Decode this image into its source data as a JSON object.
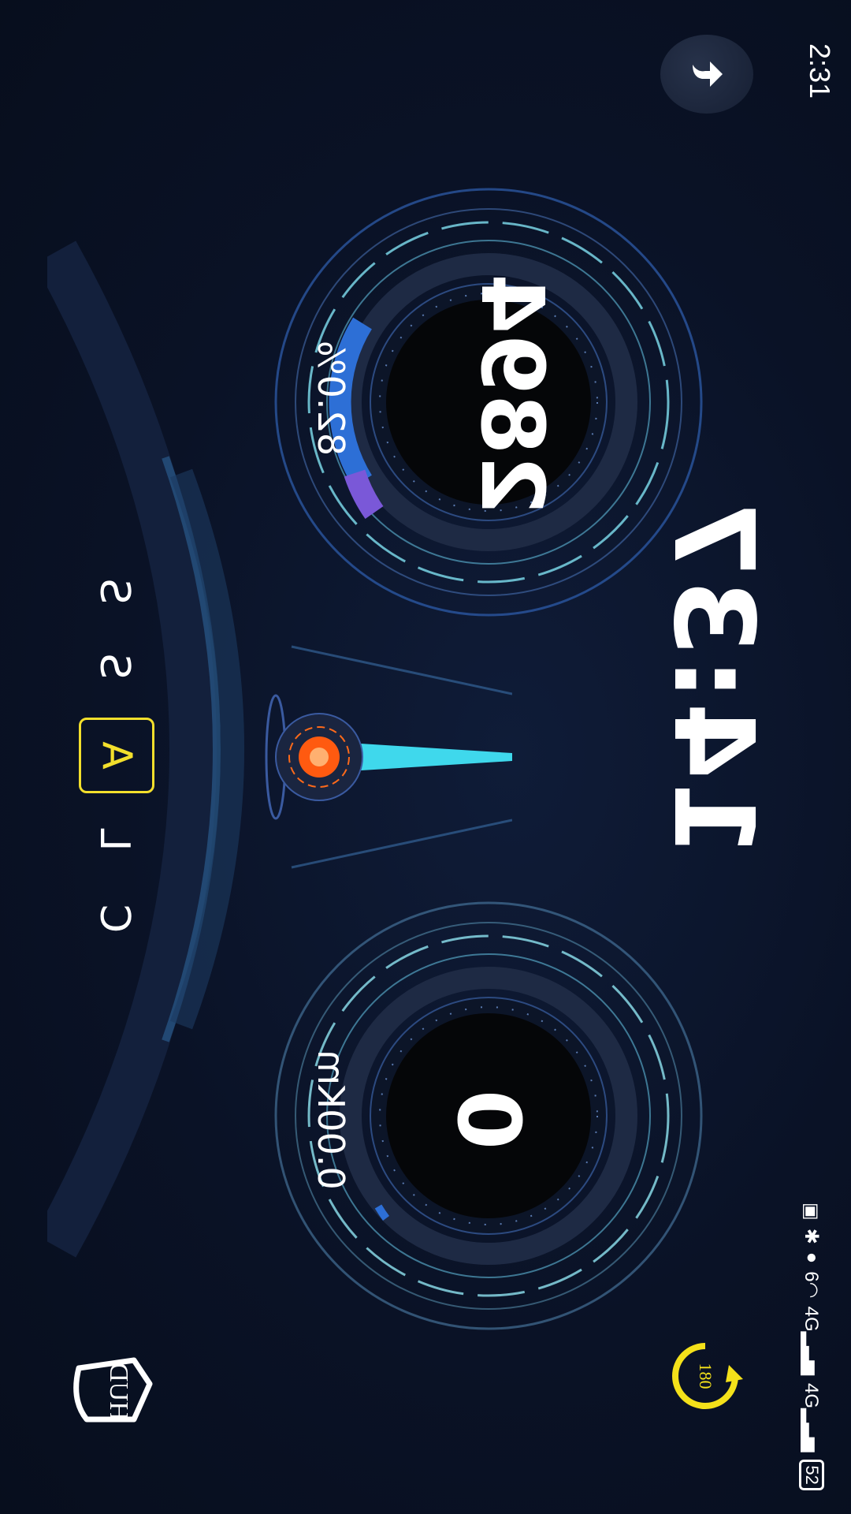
{
  "status_bar": {
    "time": "2:31",
    "network_1": "4G",
    "network_2": "4G",
    "wifi": "6",
    "battery": "52"
  },
  "controls": {
    "back_icon": "back-arrow-icon",
    "rotate_label": "180",
    "hud_label": "HUD"
  },
  "clock": {
    "time": "14:37"
  },
  "gauges": {
    "rpm": {
      "value": "2894",
      "percent": "82.0%",
      "fill_fraction": 0.82
    },
    "speed": {
      "value": "0",
      "distance": "0.00Km"
    }
  },
  "gear_selector": {
    "items": [
      "S",
      "S",
      "A",
      "L",
      "C"
    ],
    "selected": "A"
  },
  "colors": {
    "background": "#0a1226",
    "accent_yellow": "#f3df2c",
    "gauge_cyan": "#7fe0f0",
    "gauge_blue": "#2d6fd6",
    "needle_orange": "#ff6a1a"
  }
}
